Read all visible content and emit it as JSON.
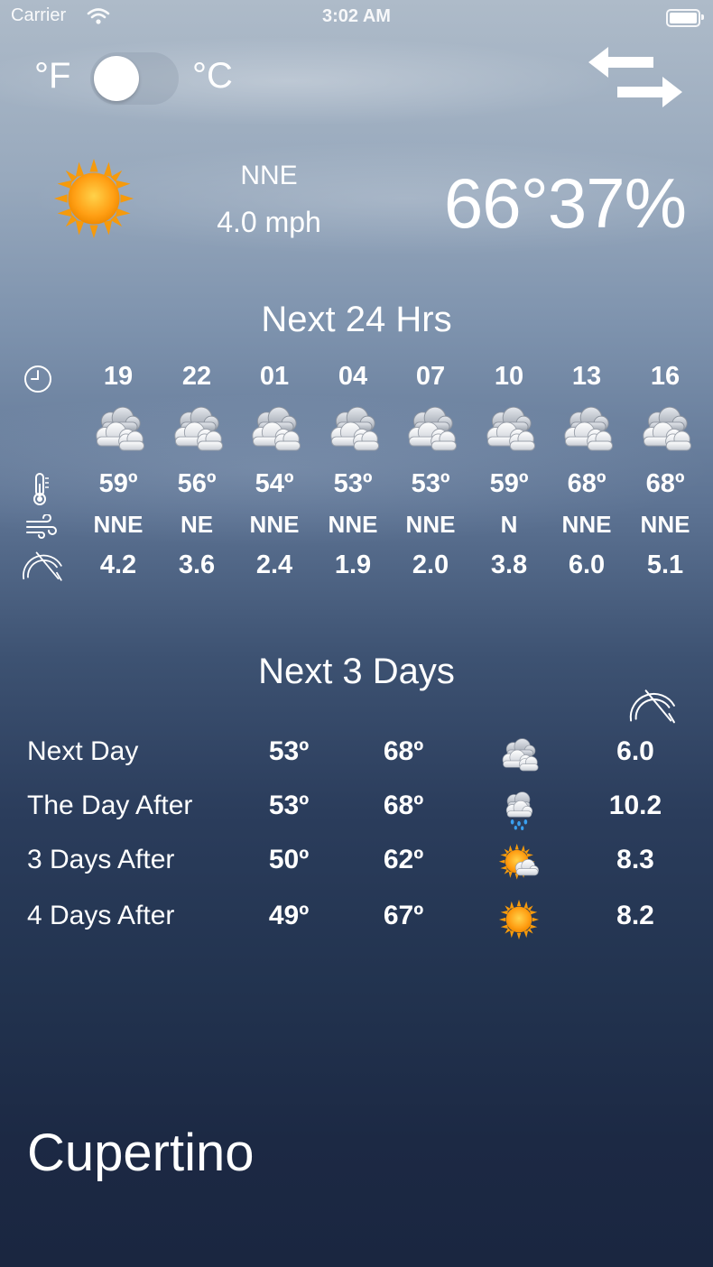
{
  "status_bar": {
    "carrier": "Carrier",
    "time": "3:02 AM"
  },
  "units": {
    "fahrenheit_label": "°F",
    "celsius_label": "°C",
    "celsius_selected": false
  },
  "current": {
    "condition_icon": "sun-icon",
    "wind_direction": "NNE",
    "wind_speed": "4.0 mph",
    "temperature": "66°",
    "humidity": "37%"
  },
  "hourly": {
    "title": "Next 24 Hrs",
    "row_icons": [
      "clock-icon",
      "thermometer-icon",
      "wind-icon",
      "gauge-icon"
    ],
    "hours": [
      {
        "hour": "19",
        "icon": "cloudy-icon",
        "temp": "59º",
        "dir": "NNE",
        "speed": "4.2"
      },
      {
        "hour": "22",
        "icon": "cloudy-icon",
        "temp": "56º",
        "dir": "NE",
        "speed": "3.6"
      },
      {
        "hour": "01",
        "icon": "cloudy-icon",
        "temp": "54º",
        "dir": "NNE",
        "speed": "2.4"
      },
      {
        "hour": "04",
        "icon": "cloudy-icon",
        "temp": "53º",
        "dir": "NNE",
        "speed": "1.9"
      },
      {
        "hour": "07",
        "icon": "cloudy-icon",
        "temp": "53º",
        "dir": "NNE",
        "speed": "2.0"
      },
      {
        "hour": "10",
        "icon": "cloudy-icon",
        "temp": "59º",
        "dir": "N",
        "speed": "3.8"
      },
      {
        "hour": "13",
        "icon": "cloudy-icon",
        "temp": "68º",
        "dir": "NNE",
        "speed": "6.0"
      },
      {
        "hour": "16",
        "icon": "cloudy-icon",
        "temp": "68º",
        "dir": "NNE",
        "speed": "5.1"
      }
    ]
  },
  "daily": {
    "title": "Next 3 Days",
    "speed_header_icon": "gauge-icon",
    "days": [
      {
        "name": "Next Day",
        "low": "53º",
        "high": "68º",
        "icon": "cloudy-icon",
        "speed": "6.0"
      },
      {
        "name": "The Day After",
        "low": "53º",
        "high": "68º",
        "icon": "rain-icon",
        "speed": "10.2"
      },
      {
        "name": "3 Days After",
        "low": "50º",
        "high": "62º",
        "icon": "partly-sunny-icon",
        "speed": "8.3"
      },
      {
        "name": "4 Days After",
        "low": "49º",
        "high": "67º",
        "icon": "sun-icon",
        "speed": "8.2"
      }
    ]
  },
  "city": "Cupertino"
}
